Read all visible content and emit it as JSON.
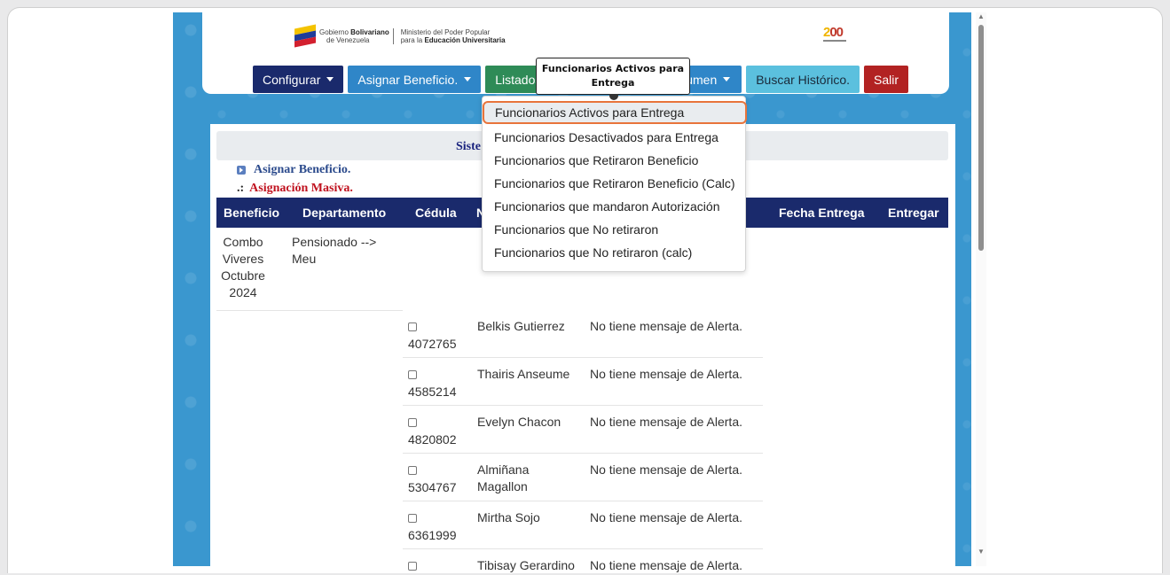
{
  "header": {
    "gov_line1": "Gobierno",
    "gov_line1_bold": "Bolivariano",
    "gov_line2": "de Venezuela",
    "ministry_line1": "Ministerio del Poder Popular",
    "ministry_line2_pre": "para la",
    "ministry_line2_bold": "Educación Universitaria",
    "logo_200_a": "2",
    "logo_200_b": "00"
  },
  "nav": {
    "configurar": "Configurar",
    "asignar": "Asignar Beneficio.",
    "listados": "Listados",
    "hidden1": "A",
    "hidden2": "sumen",
    "buscar": "Buscar Histórico.",
    "salir": "Salir"
  },
  "colors": {
    "configurar": "#1a2a6c",
    "asignar": "#2f86c8",
    "listados": "#2e8b57",
    "hidden": "#c7d9ec",
    "resumen": "#2f86c8",
    "buscar": "#5bc0de",
    "salir": "#b22222"
  },
  "tooltip": {
    "text": "Funcionarios Activos para Entrega"
  },
  "menu": {
    "items": [
      "Funcionarios Activos para Entrega",
      "Funcionarios Desactivados para Entrega",
      "Funcionarios que Retiraron Beneficio",
      "Funcionarios que Retiraron Beneficio (Calc)",
      "Funcionarios que mandaron Autorización",
      "Funcionarios que No retiraron",
      "Funcionarios que No retiraron (calc)"
    ]
  },
  "content": {
    "title_visible": "Siste",
    "link_asignar": "Asignar Beneficio.",
    "link_masiva_mark": ".:",
    "link_masiva": "Asignación Masiva."
  },
  "table": {
    "headers": {
      "beneficio": "Beneficio",
      "departamento": "Departamento",
      "cedula": "Cédula",
      "nombre_partial": "N",
      "fecha": "Fecha Entrega",
      "entregar": "Entregar"
    },
    "group": {
      "beneficio": [
        "Combo",
        "Viveres",
        "Octubre",
        "2024"
      ],
      "departamento": [
        "Pensionado -->",
        "Meu"
      ]
    },
    "rows": [
      {
        "cedula": "4072765",
        "nombre": [
          "Belkis Gutierrez"
        ],
        "alerta": "No tiene mensaje de Alerta."
      },
      {
        "cedula": "4585214",
        "nombre": [
          "Thairis Anseume"
        ],
        "alerta": "No tiene mensaje de Alerta."
      },
      {
        "cedula": "4820802",
        "nombre": [
          "Evelyn Chacon"
        ],
        "alerta": "No tiene mensaje de Alerta."
      },
      {
        "cedula": "5304767",
        "nombre": [
          "Almiñana",
          "Magallon"
        ],
        "alerta": "No tiene mensaje de Alerta."
      },
      {
        "cedula": "6361999",
        "nombre": [
          "Mirtha Sojo"
        ],
        "alerta": "No tiene mensaje de Alerta."
      },
      {
        "cedula": "",
        "nombre": [
          "Tibisay Gerardino"
        ],
        "alerta": "No tiene mensaje de Alerta."
      }
    ]
  }
}
